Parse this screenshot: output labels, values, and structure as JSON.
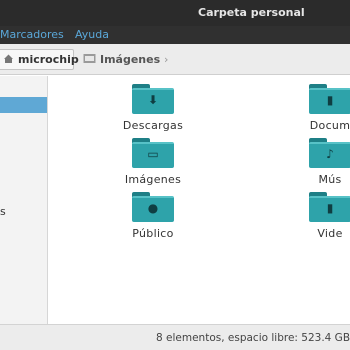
{
  "window": {
    "title": "Carpeta personal"
  },
  "menu": {
    "items": [
      "Marcadores",
      "Ayuda"
    ]
  },
  "pathbar": {
    "crumbs": [
      {
        "label": "microchip",
        "icon": "home-icon"
      },
      {
        "label": "Imágenes",
        "icon": "pictures-folder-icon"
      }
    ],
    "chevron": "›"
  },
  "sidebar": {
    "partial_label": "s"
  },
  "files": [
    {
      "label": "Descargas",
      "icon": "download-folder-icon",
      "glyph": "⬇"
    },
    {
      "label": "Docum",
      "icon": "documents-folder-icon",
      "glyph": "▮"
    },
    {
      "label": "Imágenes",
      "icon": "pictures-folder-icon",
      "glyph": "▭"
    },
    {
      "label": "Mús",
      "icon": "music-folder-icon",
      "glyph": "♪"
    },
    {
      "label": "Público",
      "icon": "public-folder-icon",
      "glyph": "●"
    },
    {
      "label": "Vide",
      "icon": "videos-folder-icon",
      "glyph": "▮"
    }
  ],
  "status": {
    "text": "8 elementos, espacio libre: 523.4 GB"
  },
  "colors": {
    "folder": "#2ea3aa",
    "selection": "#5fa8d5",
    "menu_text": "#5aa7d8"
  }
}
